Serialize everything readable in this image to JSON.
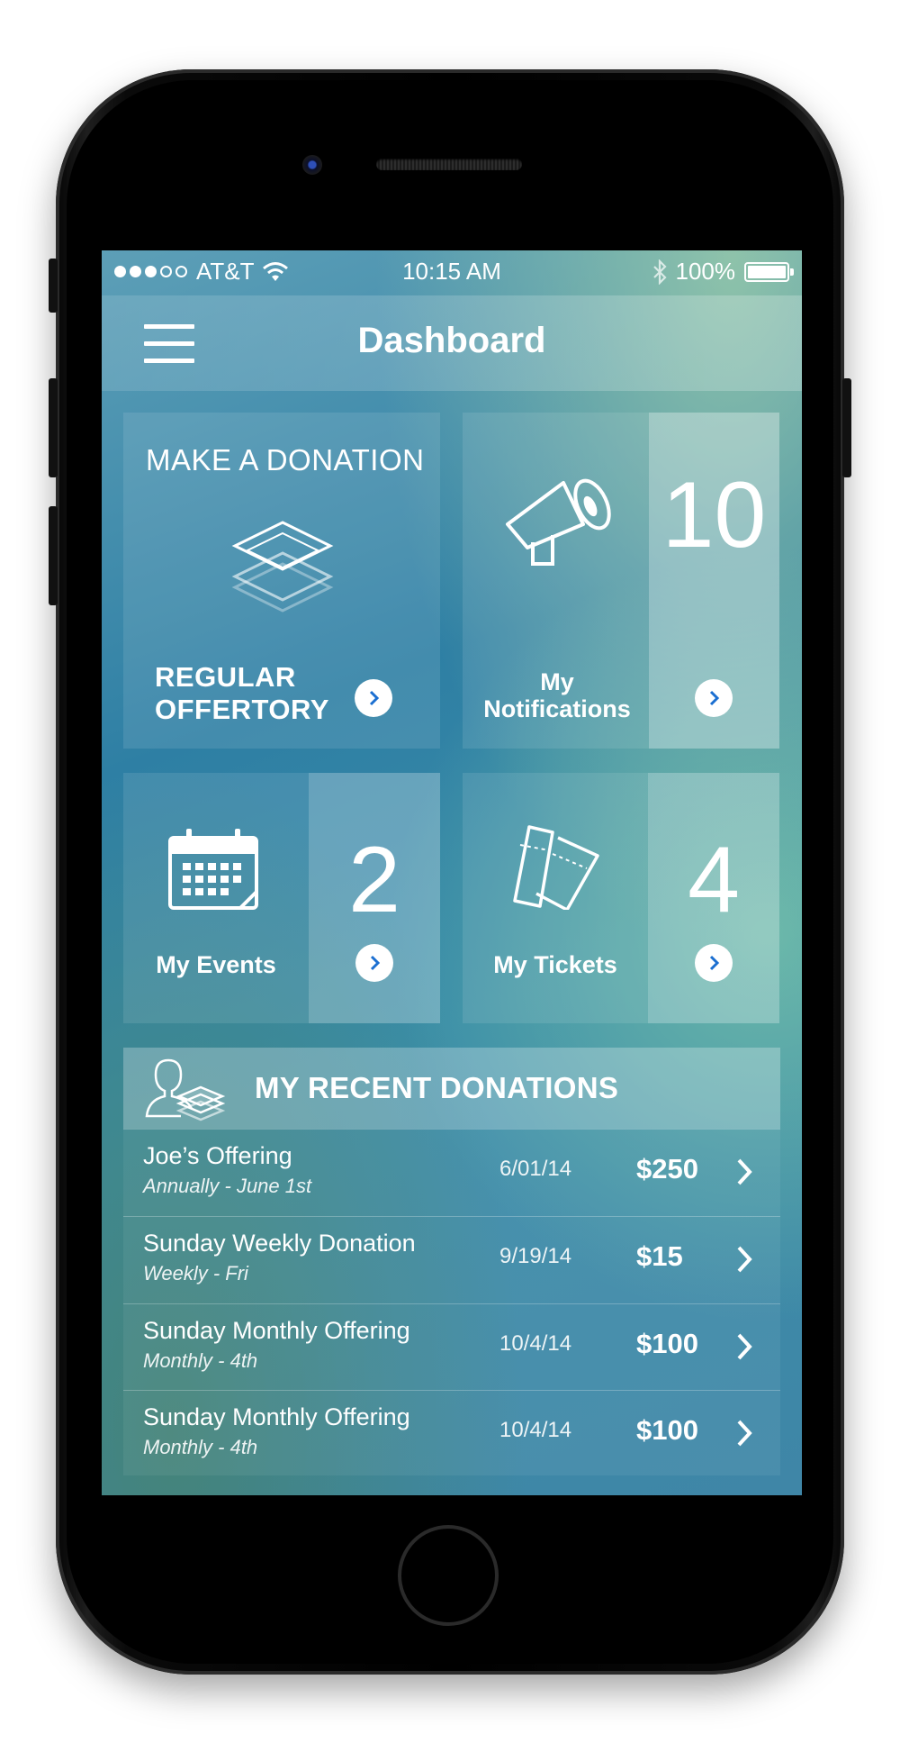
{
  "statusbar": {
    "carrier": "AT&T",
    "time": "10:15 AM",
    "battery": "100%",
    "signal_dots_filled": 3,
    "signal_dots_total": 5
  },
  "navbar": {
    "title": "Dashboard",
    "menu_icon": "hamburger-menu-icon"
  },
  "donation_card": {
    "title": "MAKE A DONATION",
    "icon": "layers-icon",
    "action_label": "REGULAR OFFERTORY"
  },
  "notifications_card": {
    "icon": "megaphone-icon",
    "label": "My Notifications",
    "count": "10"
  },
  "events_card": {
    "icon": "calendar-icon",
    "label": "My Events",
    "count": "2"
  },
  "tickets_card": {
    "icon": "tickets-icon",
    "label": "My Tickets",
    "count": "4"
  },
  "recent": {
    "title": "MY RECENT DONATIONS",
    "icon": "user-donations-icon",
    "rows": [
      {
        "name": "Joe’s Offering",
        "schedule": "Annually - June 1st",
        "date": "6/01/14",
        "amount": "$250"
      },
      {
        "name": "Sunday Weekly Donation",
        "schedule": "Weekly - Fri",
        "date": "9/19/14",
        "amount": "$15"
      },
      {
        "name": "Sunday Monthly Offering",
        "schedule": "Monthly - 4th",
        "date": "10/4/14",
        "amount": "$100"
      },
      {
        "name": "Sunday Monthly Offering",
        "schedule": "Monthly - 4th",
        "date": "10/4/14",
        "amount": "$100"
      }
    ]
  },
  "colors": {
    "accent_chevron": "#1b6fd1",
    "phone_body": "#000000",
    "text": "#ffffff"
  }
}
